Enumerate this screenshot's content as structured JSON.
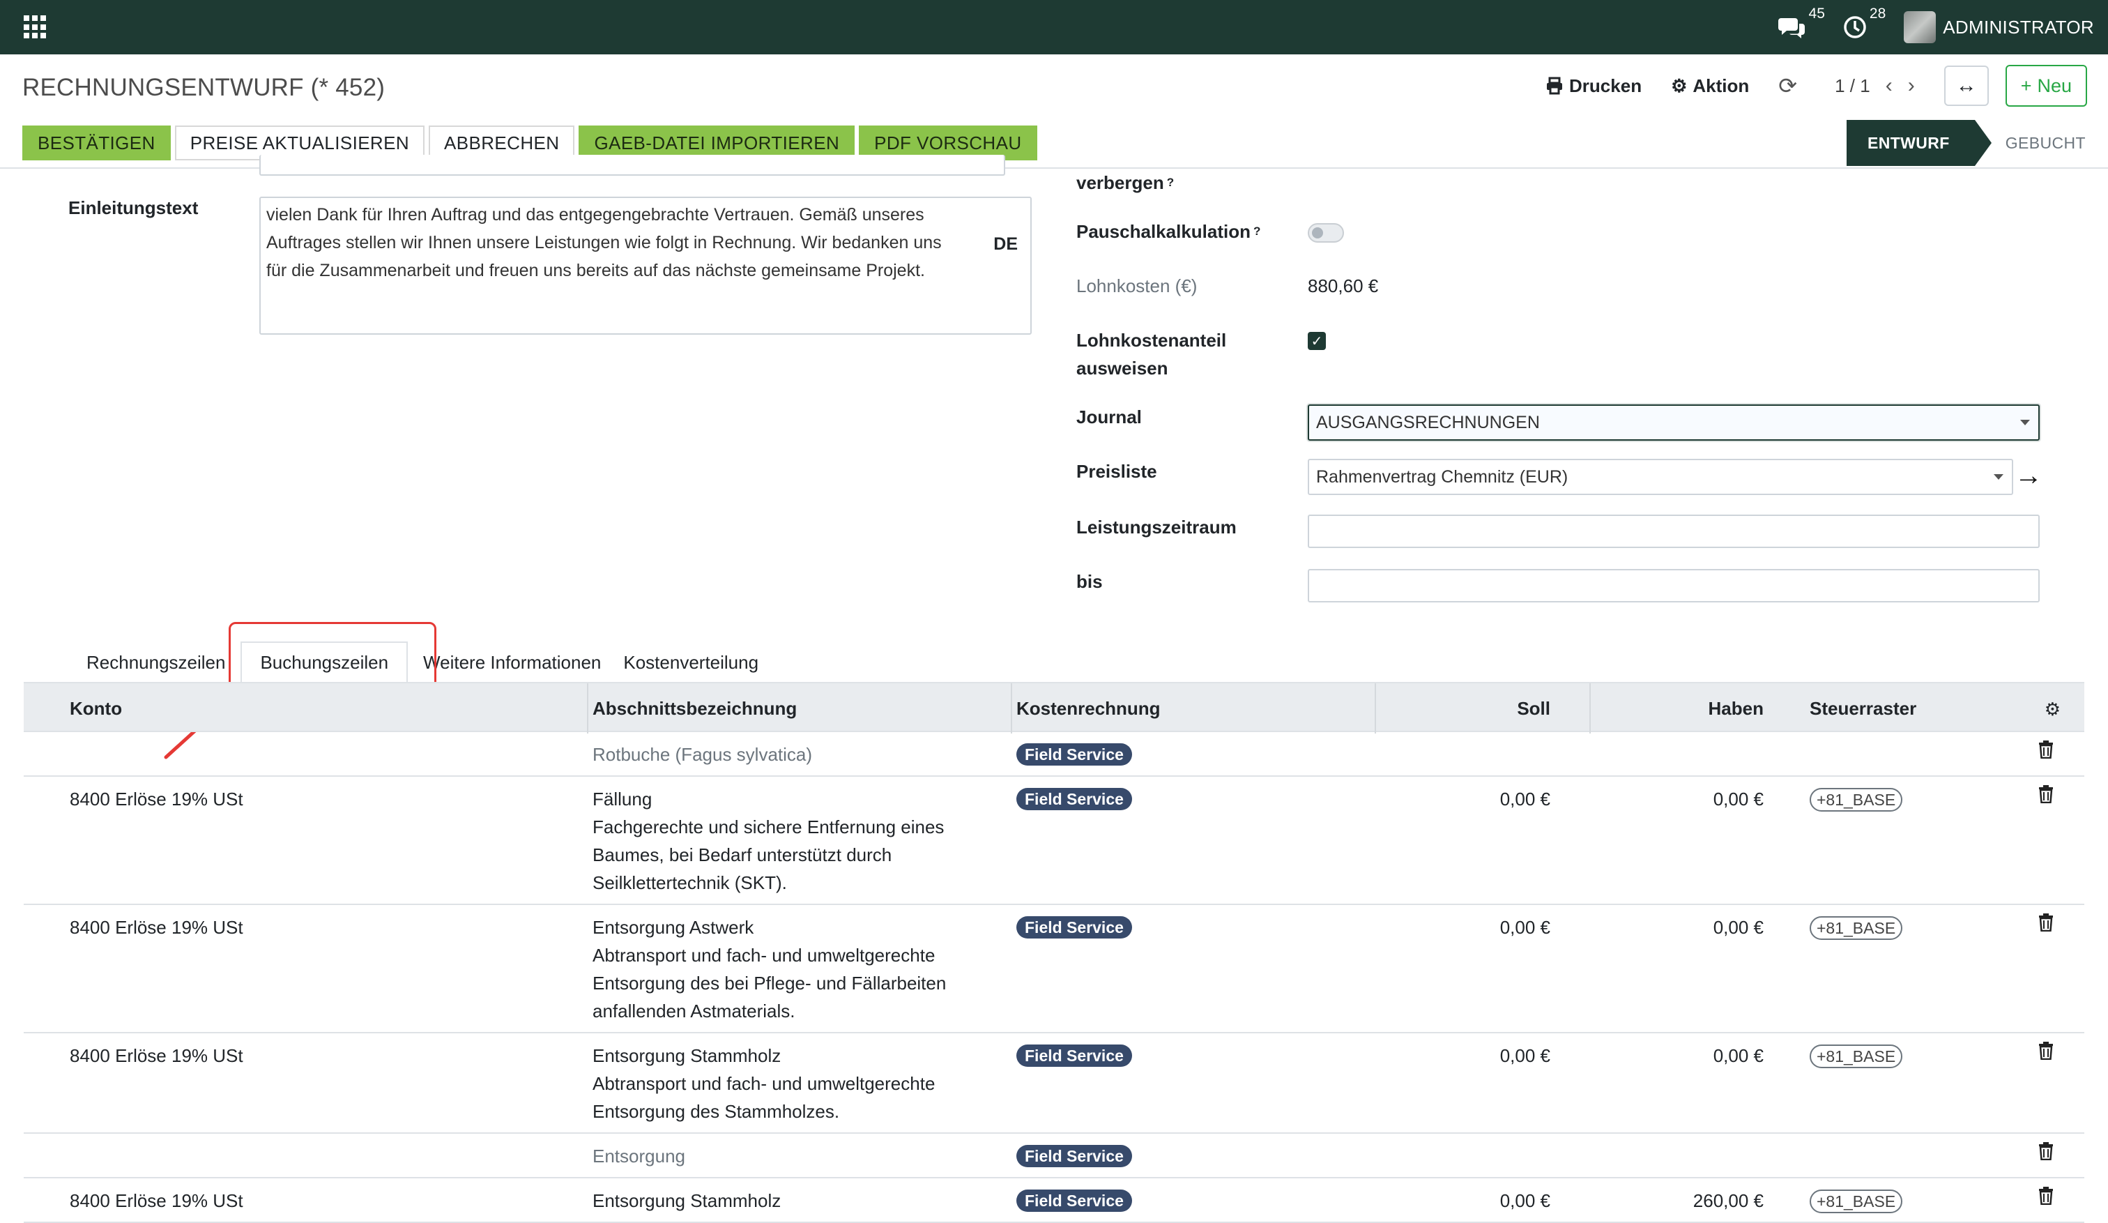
{
  "navbar": {
    "messages_count": "45",
    "activities_count": "28",
    "user": "ADMINISTRATOR"
  },
  "control": {
    "title": "RECHNUNGSENTWURF (* 452)",
    "print_label": "Drucken",
    "action_label": "Aktion",
    "pager": "1 / 1",
    "new_label": "Neu"
  },
  "actions": {
    "confirm": "BESTÄTIGEN",
    "update_prices": "PREISE AKTUALISIEREN",
    "cancel": "ABBRECHEN",
    "gaeb_import": "GAEB-DATEI IMPORTIEREN",
    "pdf_preview": "PDF VORSCHAU"
  },
  "status": {
    "active": "ENTWURF",
    "other": "GEBUCHT"
  },
  "form": {
    "intro_label": "Einleitungstext",
    "intro_text": "vielen Dank für Ihren Auftrag und das entgegengebrachte Vertrauen. Gemäß unseres Auftrages stellen wir Ihnen unsere Leistungen wie folgt in Rechnung. Wir bedanken uns für die Zusammenarbeit und freuen uns bereits auf das nächste gemeinsame Projekt.",
    "intro_lang": "DE",
    "hide_label": "verbergen",
    "flat_calc_label": "Pauschalkalkulation",
    "labor_cost_label": "Lohnkosten (€)",
    "labor_cost_value": "880,60 €",
    "show_labor_label_1": "Lohnkostenanteil",
    "show_labor_label_2": "ausweisen",
    "journal_label": "Journal",
    "journal_value": "AUSGANGSRECHNUNGEN",
    "pricelist_label": "Preisliste",
    "pricelist_value": "Rahmenvertrag Chemnitz (EUR)",
    "period_label": "Leistungszeitraum",
    "until_label": "bis",
    "help_mark": "?"
  },
  "tabs": [
    "Rechnungszeilen",
    "Buchungszeilen",
    "Weitere Informationen",
    "Kostenverteilung"
  ],
  "table": {
    "headers": {
      "account": "Konto",
      "section": "Abschnittsbezeichnung",
      "cost": "Kostenrechnung",
      "debit": "Soll",
      "credit": "Haben",
      "tax_grid": "Steuerraster"
    },
    "rows": [
      {
        "account": "",
        "section": [
          "Rotbuche (Fagus sylvatica)"
        ],
        "section_muted": true,
        "cost": "Field Service",
        "debit": "",
        "credit": "",
        "tax": ""
      },
      {
        "account": "8400 Erlöse 19% USt",
        "section": [
          "Fällung",
          "Fachgerechte und sichere Entfernung eines",
          "Baumes, bei Bedarf unterstützt durch",
          "Seilklettertechnik (SKT)."
        ],
        "section_muted": false,
        "cost": "Field Service",
        "debit": "0,00 €",
        "credit": "0,00 €",
        "tax": "+81_BASE"
      },
      {
        "account": "8400 Erlöse 19% USt",
        "section": [
          "Entsorgung Astwerk",
          "Abtransport und fach- und umweltgerechte",
          "Entsorgung des bei Pflege- und Fällarbeiten",
          "anfallenden Astmaterials."
        ],
        "section_muted": false,
        "cost": "Field Service",
        "debit": "0,00 €",
        "credit": "0,00 €",
        "tax": "+81_BASE"
      },
      {
        "account": "8400 Erlöse 19% USt",
        "section": [
          "Entsorgung Stammholz",
          "Abtransport und fach- und umweltgerechte",
          "Entsorgung des Stammholzes."
        ],
        "section_muted": false,
        "cost": "Field Service",
        "debit": "0,00 €",
        "credit": "0,00 €",
        "tax": "+81_BASE"
      },
      {
        "account": "",
        "section": [
          "Entsorgung"
        ],
        "section_muted": true,
        "cost": "Field Service",
        "debit": "",
        "credit": "",
        "tax": ""
      },
      {
        "account": "8400 Erlöse 19% USt",
        "section": [
          "Entsorgung Stammholz"
        ],
        "section_muted": false,
        "cost": "Field Service",
        "debit": "0,00 €",
        "credit": "260,00 €",
        "tax": "+81_BASE"
      }
    ]
  }
}
